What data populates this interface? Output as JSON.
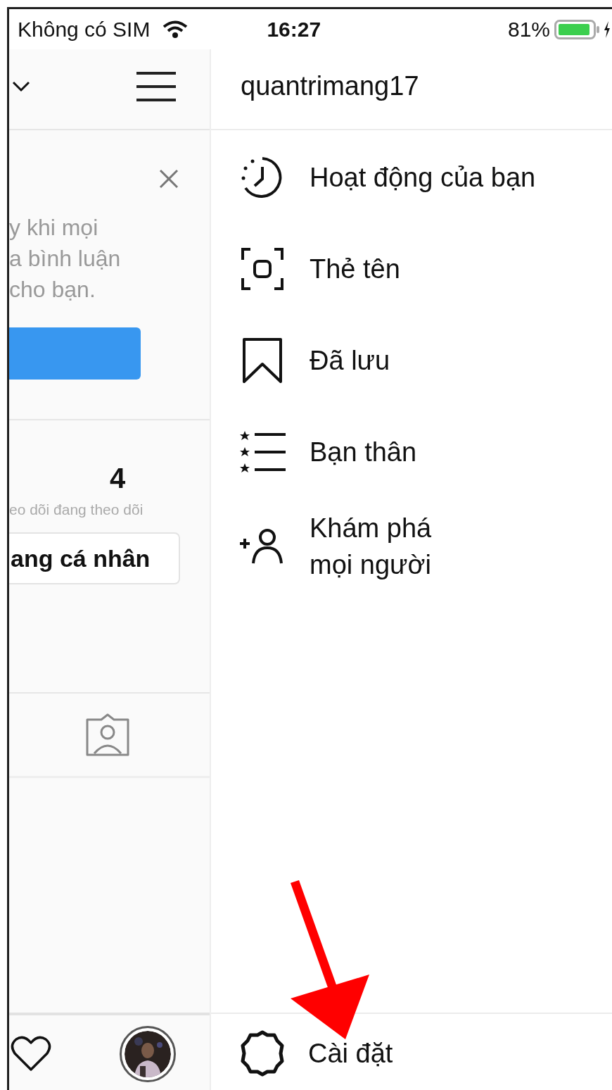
{
  "status_bar": {
    "carrier": "Không có SIM",
    "time": "16:27",
    "battery": "81%"
  },
  "left_panel": {
    "notice_lines": [
      "y khi mọi",
      "a bình luận",
      "cho bạn."
    ],
    "stat_count": "4",
    "stat_label": "eo dõi đang theo dõi",
    "profile_button": "ang cá nhân"
  },
  "menu": {
    "username": "quantrimang17",
    "items": [
      {
        "kind": "activity",
        "label": "Hoạt động của bạn"
      },
      {
        "kind": "nametag",
        "label": "Thẻ tên"
      },
      {
        "kind": "saved",
        "label": "Đã lưu"
      },
      {
        "kind": "close_friends",
        "label": "Bạn thân"
      },
      {
        "kind": "discover",
        "label": "Khám phá mọi người"
      }
    ],
    "settings": "Cài đặt"
  }
}
